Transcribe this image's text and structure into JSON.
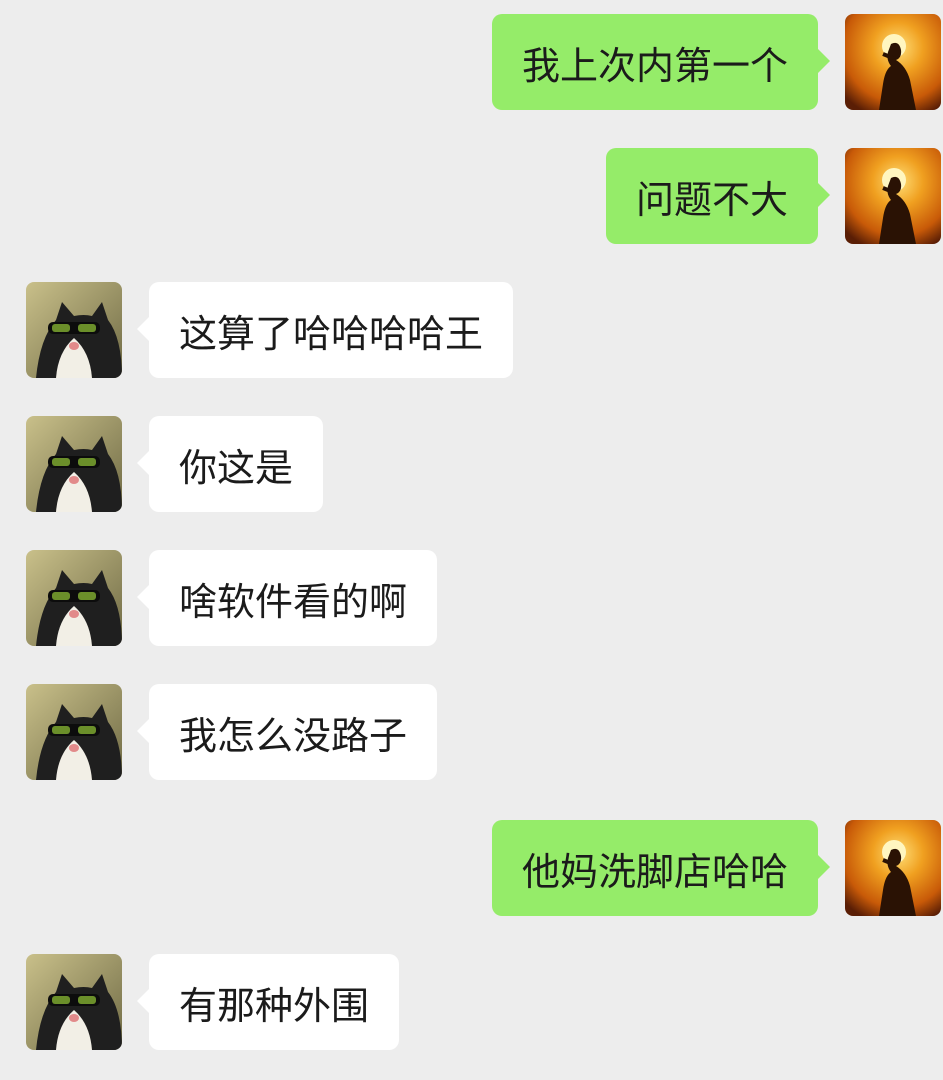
{
  "messages": [
    {
      "side": "right",
      "text": "我上次内第一个"
    },
    {
      "side": "right",
      "text": "问题不大"
    },
    {
      "side": "left",
      "text": "这算了哈哈哈哈王"
    },
    {
      "side": "left",
      "text": "你这是"
    },
    {
      "side": "left",
      "text": "啥软件看的啊"
    },
    {
      "side": "left",
      "text": "我怎么没路子"
    },
    {
      "side": "right",
      "text": "他妈洗脚店哈哈"
    },
    {
      "side": "left",
      "text": "有那种外围"
    }
  ],
  "avatars": {
    "self": "silhouette-avatar-icon",
    "other": "cat-sunglasses-avatar-icon"
  },
  "colors": {
    "background": "#ededed",
    "sent_bubble": "#95ec69",
    "received_bubble": "#ffffff"
  }
}
